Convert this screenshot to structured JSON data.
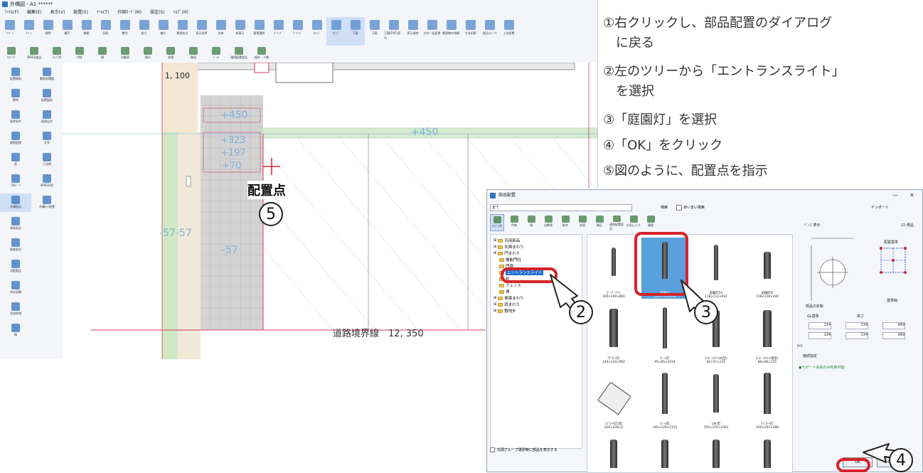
{
  "app": {
    "title": "外構図 - A1 ******",
    "menus": [
      "ﾌｧｲﾙ(F)",
      "編集(E)",
      "表示(V)",
      "配置(S)",
      "ﾂｰﾙ(T)",
      "作図ﾓｰﾄﾞ(M)",
      "設定(S)",
      "ﾍﾙﾌﾟ(H)"
    ],
    "ribbon_top": [
      "ｱﾝﾄﾞｩ",
      "ﾘﾄﾞｩ",
      "削除",
      "複写",
      "移動",
      "回転",
      "整列",
      "拡大",
      "縮小",
      "範囲拡大",
      "表示倍率",
      "全体",
      "前表示",
      "要素選択",
      "ｸﾞﾘｯﾄﾞ",
      "ｸﾞﾘｯﾄﾞ",
      "ｽﾅｯﾌﾟ",
      "ｽﾅｯﾌﾟ",
      "下図",
      "下図",
      "下図(DXF)読込",
      "表示部材",
      "文字一括変更",
      "範囲線の移動",
      "寸法切替",
      "部品ﾗｲﾌﾞﾗﾘ",
      "上位配置"
    ],
    "ribbon_second": [
      "ｶﾃｺﾞﾘｰ",
      "SPEED部品",
      "ﾀｲﾌﾟ別",
      "門柱",
      "塀",
      "自動車",
      "植木",
      "花壇",
      "階段",
      "ﾃﾞｯｷ",
      "連続配置部品",
      "植木・人物"
    ],
    "left_panel": [
      "配置補助",
      "敷地求積図",
      "敷地",
      "配置図設",
      "境界条件",
      "画像出力",
      "建物配置",
      "文字",
      "面",
      "寸法線",
      "2Dﾊﾟｰﾂ",
      "SPEED3D",
      "外構部品",
      "外構ｶｯﾄ配置",
      "建具部品",
      "",
      "植栽部品",
      "",
      "化粧製品",
      "",
      "排水設備",
      "",
      "用途地域",
      "",
      "線",
      ""
    ],
    "canvas": {
      "dim_top": "1, 100",
      "label_450a": "+450",
      "label_450b": "+450",
      "label_323": "+323",
      "label_197": "+197",
      "label_70": "+70",
      "label_57": "-57-57",
      "label_57b": "-57",
      "road_label": "道路境界線　12, 350",
      "placement_label": "配置点",
      "placement_number": "5"
    }
  },
  "instructions": [
    "①右クリックし、部品配置のダイアログ",
    "　に戻る",
    "②左のツリーから「エントランスライト」",
    "　を選択",
    "③「庭園灯」を選択",
    "④「OK」をクリック",
    "⑤図のように、配置点を指示"
  ],
  "dialog": {
    "title": "部品配置",
    "category_value": "全て",
    "search_label": "検索",
    "fuzzy_search": "あいまい検索",
    "import_label": "インポート",
    "toolbar": [
      "ｶﾃｺﾞﾘ別",
      "門扉",
      "塀",
      "自動車",
      "植木",
      "花壇",
      "階石",
      "連続配置部品",
      "お気に入り",
      "履歴"
    ],
    "tree": [
      {
        "label": "汎用部品",
        "level": 0
      },
      {
        "label": "玄関まわり",
        "level": 0
      },
      {
        "label": "門まわり",
        "level": 0
      },
      {
        "label": "機能門柱",
        "level": 1
      },
      {
        "label": "門扉",
        "level": 1
      },
      {
        "label": "エントランスライト",
        "level": 1
      },
      {
        "label": "柱",
        "level": 1
      },
      {
        "label": "フェンス",
        "level": 1
      },
      {
        "label": "塀",
        "level": 1
      },
      {
        "label": "車庫まわり",
        "level": 0
      },
      {
        "label": "庭まわり",
        "level": 0
      },
      {
        "label": "敷地外",
        "level": 0
      }
    ],
    "tree_footer": "先頭グループ選択時に部品を表示する",
    "items": [
      {
        "name": "ｶﾞｰﾃﾞﾝﾗｲﾄ",
        "size": "100×100×800"
      },
      {
        "name": "庭園灯",
        "size": "134×134×999"
      },
      {
        "name": "庭園灯5A",
        "size": "118×112×932"
      },
      {
        "name": "庭園灯B",
        "size": "118×118×440"
      },
      {
        "name": "ｱﾌﾟﾛｰﾁ灯",
        "size": "144×144×992"
      },
      {
        "name": "ﾎﾟｰﾙ灯",
        "size": "95×95×1018"
      },
      {
        "name": "ﾛｰﾎﾞｰﾙﾗｲﾄ(丸型)",
        "size": "82×51×315"
      },
      {
        "name": "ﾛｰﾎﾞｰﾙﾗｲﾄ(角型)",
        "size": "80×80×315"
      },
      {
        "name": "ｱﾌﾟﾛｰﾁ灯2型",
        "size": "228×228×2"
      },
      {
        "name": "ﾎﾟｰﾙ型",
        "size": "145×129×1155"
      },
      {
        "name": "GK-型",
        "size": "155×155×1002"
      },
      {
        "name": "ｱﾌﾟﾛｰﾁ灯",
        "size": "200×207×288"
      }
    ],
    "count_label": "15 部品",
    "view_label": "ﾍﾟｰｼﾞ表示",
    "layout_label": "配置基準",
    "height_label": "高さ",
    "gl_label": "GL基準",
    "dims": [
      "134",
      "134",
      "999",
      "134",
      "134",
      "999"
    ],
    "angle_label": "部品の反転",
    "other_label": "ﾀｲﾙ",
    "base_label": "基準線",
    "color_label": "継続指定",
    "note": "●サポート会員のみ利用可能",
    "ok_label": "OK",
    "cancel_label": "ｷｬﾝｾﾙ"
  },
  "callouts": {
    "two": "2",
    "three": "3",
    "four": "4"
  }
}
